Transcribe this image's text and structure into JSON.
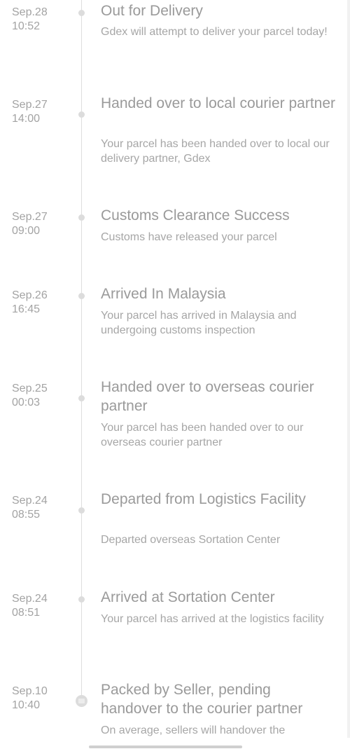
{
  "tracking": {
    "events": [
      {
        "date": "Sep.28",
        "time": "10:52",
        "title": "Out for Delivery",
        "description": "Gdex will attempt to deliver your parcel today!"
      },
      {
        "date": "Sep.27",
        "time": "14:00",
        "title": "Handed over to local courier partner",
        "description": "Your parcel has been handed over to local our delivery partner, Gdex"
      },
      {
        "date": "Sep.27",
        "time": "09:00",
        "title": "Customs Clearance Success",
        "description": "Customs have released your parcel"
      },
      {
        "date": "Sep.26",
        "time": "16:45",
        "title": "Arrived In Malaysia",
        "description": "Your parcel has arrived in Malaysia and undergoing customs inspection"
      },
      {
        "date": "Sep.25",
        "time": "00:03",
        "title": "Handed over to overseas courier partner",
        "description": "Your parcel has been handed over to our overseas courier partner"
      },
      {
        "date": "Sep.24",
        "time": "08:55",
        "title": "Departed from Logistics Facility",
        "description": "Departed overseas Sortation Center"
      },
      {
        "date": "Sep.24",
        "time": "08:51",
        "title": "Arrived at Sortation Center",
        "description": "Your parcel has arrived at the logistics facility"
      },
      {
        "date": "Sep.10",
        "time": "10:40",
        "title": "Packed by Seller, pending handover to the courier partner",
        "description": "On average, sellers will handover the",
        "icon": "package-icon"
      }
    ]
  },
  "colors": {
    "text_muted": "#9a9a9a",
    "line": "#dedede",
    "dot": "#dcdcdc"
  }
}
